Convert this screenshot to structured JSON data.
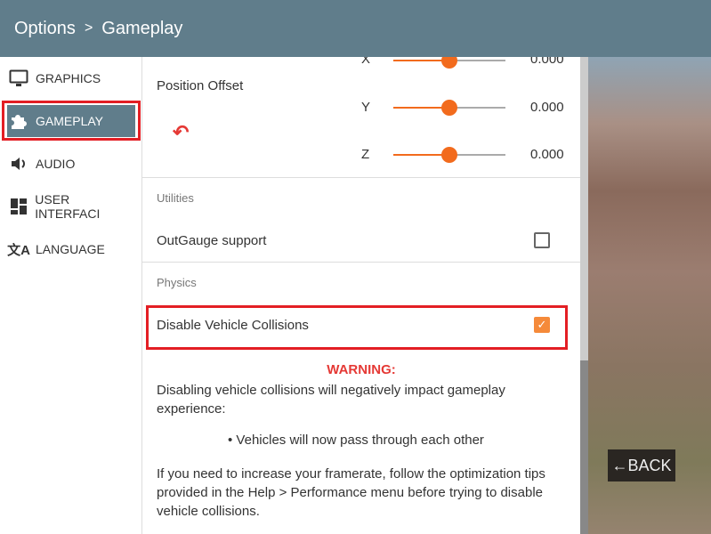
{
  "header": {
    "title": "Options",
    "separator": ">",
    "page": "Gameplay"
  },
  "sidebar": {
    "items": [
      {
        "label": "GRAPHICS",
        "icon": "monitor-icon"
      },
      {
        "label": "GAMEPLAY",
        "icon": "puzzle-icon",
        "active": true
      },
      {
        "label": "AUDIO",
        "icon": "speaker-icon"
      },
      {
        "label": "USER INTERFACI",
        "icon": "dashboard-icon"
      },
      {
        "label": "LANGUAGE",
        "icon": "translate-icon"
      }
    ]
  },
  "position_offset": {
    "label": "Position Offset",
    "axes": [
      {
        "label": "X",
        "value": "0.000",
        "fraction": 0.5
      },
      {
        "label": "Y",
        "value": "0.000",
        "fraction": 0.5
      },
      {
        "label": "Z",
        "value": "0.000",
        "fraction": 0.5
      }
    ]
  },
  "utilities": {
    "heading": "Utilities",
    "outgauge_label": "OutGauge support",
    "outgauge_checked": false
  },
  "physics": {
    "heading": "Physics",
    "disable_collisions_label": "Disable Vehicle Collisions",
    "disable_collisions_checked": true
  },
  "warning": {
    "title": "WARNING:",
    "text": "Disabling vehicle collisions will negatively impact gameplay experience:",
    "bullet": "Vehicles will now pass through each other",
    "tip": "If you need to increase your framerate, follow the optimization tips provided in the Help > Performance menu before trying to disable vehicle collisions."
  },
  "back_label": "←BACK",
  "colors": {
    "header": "#607d8b",
    "accent": "#f26b1d",
    "highlight": "#e31e24",
    "warning": "#e53935"
  }
}
